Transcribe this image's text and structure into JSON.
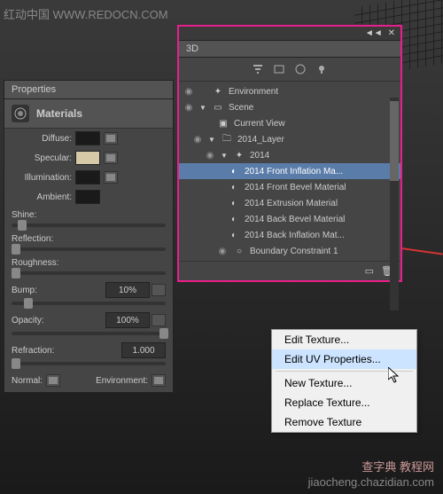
{
  "watermark": {
    "top": "红动中国 WWW.REDOCN.COM",
    "bottom_line1": "查字典 教程网",
    "bottom_line2": "jiaocheng.chazidian.com"
  },
  "properties": {
    "tab": "Properties",
    "title": "Materials",
    "diffuse": "Diffuse:",
    "specular": "Specular:",
    "illumination": "Illumination:",
    "ambient": "Ambient:",
    "shine": "Shine:",
    "reflection": "Reflection:",
    "roughness": "Roughness:",
    "bump": "Bump:",
    "bump_value": "10%",
    "opacity": "Opacity:",
    "opacity_value": "100%",
    "refraction": "Refraction:",
    "refraction_value": "1.000",
    "normal": "Normal:",
    "environment": "Environment:",
    "colors": {
      "diffuse": "#1a1a1a",
      "specular": "#d6c9a8",
      "illumination": "#1a1a1a",
      "ambient": "#1a1a1a"
    }
  },
  "panel3d": {
    "tab": "3D",
    "tree": {
      "environment": "Environment",
      "scene": "Scene",
      "current_view": "Current View",
      "layer": "2014_Layer",
      "mesh": "2014",
      "materials": [
        "2014 Front Inflation Ma...",
        "2014 Front Bevel Material",
        "2014 Extrusion Material",
        "2014 Back Bevel Material",
        "2014 Back Inflation Mat..."
      ],
      "boundary": "Boundary Constraint 1"
    }
  },
  "context_menu": {
    "items": [
      "Edit Texture...",
      "Edit UV Properties...",
      "New Texture...",
      "Replace Texture...",
      "Remove Texture"
    ],
    "highlighted_index": 1
  }
}
